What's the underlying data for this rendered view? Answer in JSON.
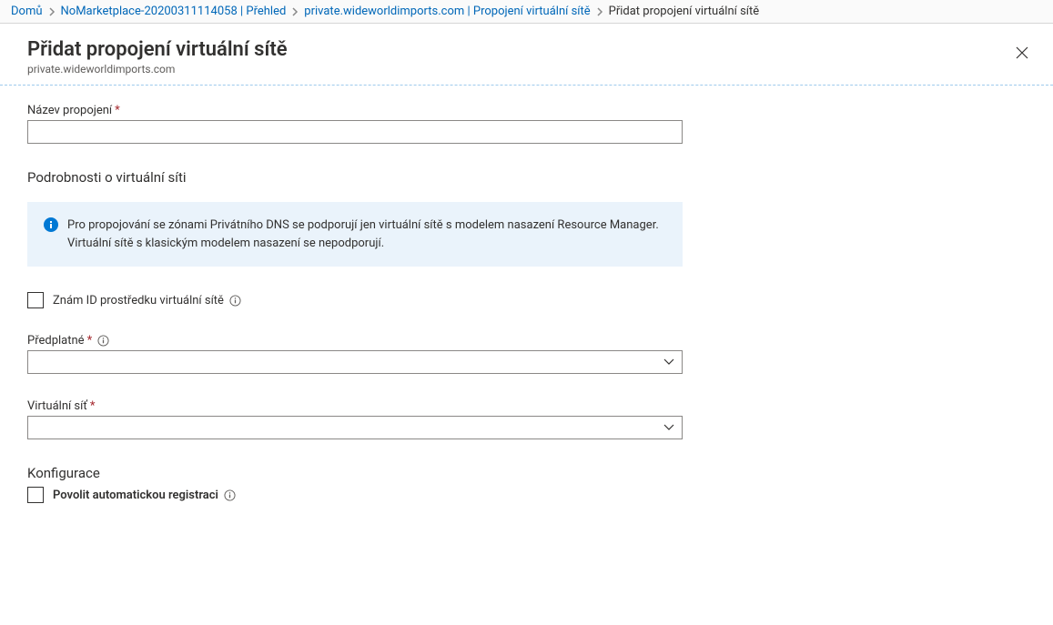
{
  "breadcrumb": {
    "items": [
      {
        "label": "Domů"
      },
      {
        "label": "NoMarketplace-20200311114058 | Přehled"
      },
      {
        "label": "private.wideworldimports.com | Propojení virtuální sítě"
      }
    ],
    "current": "Přidat propojení virtuální sítě"
  },
  "header": {
    "title": "Přidat propojení virtuální sítě",
    "subtitle": "private.wideworldimports.com"
  },
  "form": {
    "link_name_label": "Název propojení",
    "link_name_value": "",
    "vnet_section_heading": "Podrobnosti o virtuální síti",
    "info_banner": "Pro propojování se zónami Privátního DNS se podporují jen virtuální sítě s modelem nasazení Resource Manager. Virtuální sítě s klasickým modelem nasazení se nepodporují.",
    "know_resource_id_label": "Znám ID prostředku virtuální sítě",
    "subscription_label": "Předplatné",
    "subscription_value": "",
    "vnet_label": "Virtuální síť",
    "vnet_value": "",
    "config_heading": "Konfigurace",
    "auto_register_label": "Povolit automatickou registraci"
  }
}
